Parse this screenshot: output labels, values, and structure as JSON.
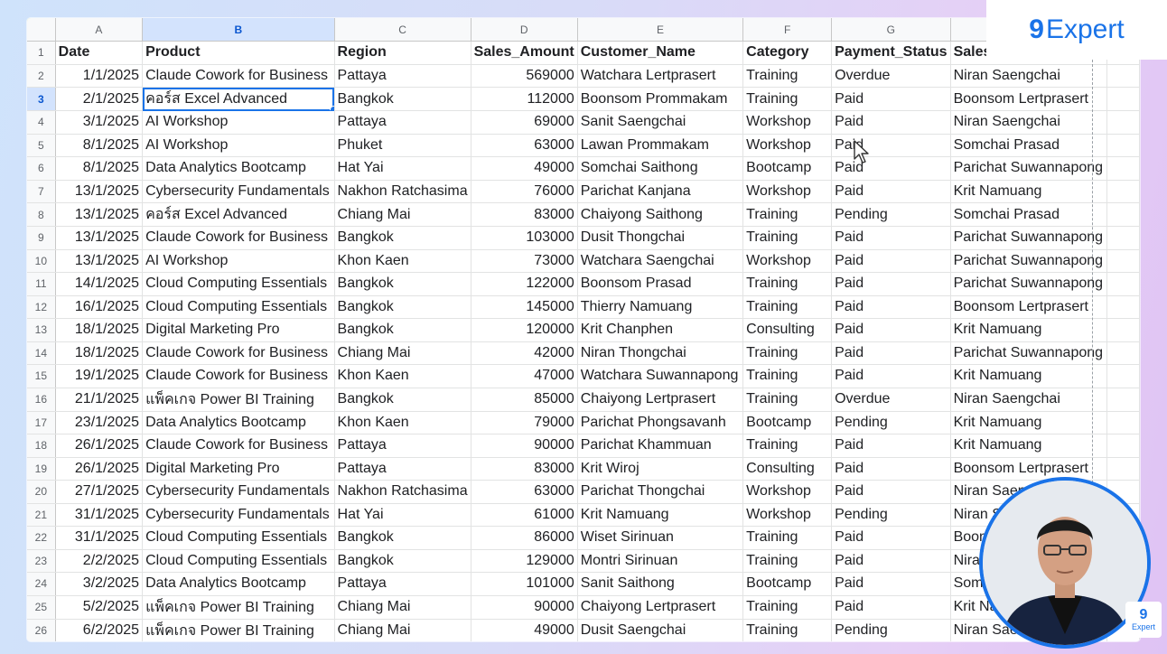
{
  "brand": {
    "logo_mark": "9",
    "logo_text": "Expert",
    "mini_mark": "9",
    "mini_text": "Expert"
  },
  "colors": {
    "accent": "#1a73e8",
    "selection": "#d3e3fd"
  },
  "sheet": {
    "column_letters": [
      "A",
      "B",
      "C",
      "D",
      "E",
      "F",
      "G",
      ""
    ],
    "headers": [
      "Date",
      "Product",
      "Region",
      "Sales_Amount",
      "Customer_Name",
      "Category",
      "Payment_Status",
      "Sales_Rep"
    ],
    "selected_column": "B",
    "active_cell": "B3",
    "rows": [
      [
        "1/1/2025",
        "Claude Cowork for Business",
        "Pattaya",
        "569000",
        "Watchara Lertprasert",
        "Training",
        "Overdue",
        "Niran Saengchai"
      ],
      [
        "2/1/2025",
        "คอร์ส Excel Advanced",
        "Bangkok",
        "112000",
        "Boonsom Prommakam",
        "Training",
        "Paid",
        "Boonsom Lertprasert"
      ],
      [
        "3/1/2025",
        "AI Workshop",
        "Pattaya",
        "69000",
        "Sanit Saengchai",
        "Workshop",
        "Paid",
        "Niran Saengchai"
      ],
      [
        "8/1/2025",
        "AI Workshop",
        "Phuket",
        "63000",
        "Lawan Prommakam",
        "Workshop",
        "Paid",
        "Somchai Prasad"
      ],
      [
        "8/1/2025",
        "Data Analytics Bootcamp",
        "Hat Yai",
        "49000",
        "Somchai Saithong",
        "Bootcamp",
        "Paid",
        "Parichat Suwannapong"
      ],
      [
        "13/1/2025",
        "Cybersecurity Fundamentals",
        "Nakhon Ratchasima",
        "76000",
        "Parichat Kanjana",
        "Workshop",
        "Paid",
        "Krit Namuang"
      ],
      [
        "13/1/2025",
        "คอร์ส Excel Advanced",
        "Chiang Mai",
        "83000",
        "Chaiyong Saithong",
        "Training",
        "Pending",
        "Somchai Prasad"
      ],
      [
        "13/1/2025",
        "Claude Cowork for Business",
        "Bangkok",
        "103000",
        "Dusit Thongchai",
        "Training",
        "Paid",
        "Parichat Suwannapong"
      ],
      [
        "13/1/2025",
        "AI Workshop",
        "Khon Kaen",
        "73000",
        "Watchara Saengchai",
        "Workshop",
        "Paid",
        "Parichat Suwannapong"
      ],
      [
        "14/1/2025",
        "Cloud Computing Essentials",
        "Bangkok",
        "122000",
        "Boonsom Prasad",
        "Training",
        "Paid",
        "Parichat Suwannapong"
      ],
      [
        "16/1/2025",
        "Cloud Computing Essentials",
        "Bangkok",
        "145000",
        "Thierry Namuang",
        "Training",
        "Paid",
        "Boonsom Lertprasert"
      ],
      [
        "18/1/2025",
        "Digital Marketing Pro",
        "Bangkok",
        "120000",
        "Krit Chanphen",
        "Consulting",
        "Paid",
        "Krit Namuang"
      ],
      [
        "18/1/2025",
        "Claude Cowork for Business",
        "Chiang Mai",
        "42000",
        "Niran Thongchai",
        "Training",
        "Paid",
        "Parichat Suwannapong"
      ],
      [
        "19/1/2025",
        "Claude Cowork for Business",
        "Khon Kaen",
        "47000",
        "Watchara Suwannapong",
        "Training",
        "Paid",
        "Krit Namuang"
      ],
      [
        "21/1/2025",
        "แพ็คเกจ Power BI Training",
        "Bangkok",
        "85000",
        "Chaiyong Lertprasert",
        "Training",
        "Overdue",
        "Niran Saengchai"
      ],
      [
        "23/1/2025",
        "Data Analytics Bootcamp",
        "Khon Kaen",
        "79000",
        "Parichat Phongsavanh",
        "Bootcamp",
        "Pending",
        "Krit Namuang"
      ],
      [
        "26/1/2025",
        "Claude Cowork for Business",
        "Pattaya",
        "90000",
        "Parichat Khammuan",
        "Training",
        "Paid",
        "Krit Namuang"
      ],
      [
        "26/1/2025",
        "Digital Marketing Pro",
        "Pattaya",
        "83000",
        "Krit Wiroj",
        "Consulting",
        "Paid",
        "Boonsom Lertprasert"
      ],
      [
        "27/1/2025",
        "Cybersecurity Fundamentals",
        "Nakhon Ratchasima",
        "63000",
        "Parichat Thongchai",
        "Workshop",
        "Paid",
        "Niran Saengchai"
      ],
      [
        "31/1/2025",
        "Cybersecurity Fundamentals",
        "Hat Yai",
        "61000",
        "Krit Namuang",
        "Workshop",
        "Pending",
        "Niran Saengchai"
      ],
      [
        "31/1/2025",
        "Cloud Computing Essentials",
        "Bangkok",
        "86000",
        "Wiset Sirinuan",
        "Training",
        "Paid",
        "Boonsom Lertprasert"
      ],
      [
        "2/2/2025",
        "Cloud Computing Essentials",
        "Bangkok",
        "129000",
        "Montri Sirinuan",
        "Training",
        "Paid",
        "Niran Saengchai"
      ],
      [
        "3/2/2025",
        "Data Analytics Bootcamp",
        "Pattaya",
        "101000",
        "Sanit Saithong",
        "Bootcamp",
        "Paid",
        "Somchai Prasad"
      ],
      [
        "5/2/2025",
        "แพ็คเกจ Power BI Training",
        "Chiang Mai",
        "90000",
        "Chaiyong Lertprasert",
        "Training",
        "Paid",
        "Krit Namuang"
      ],
      [
        "6/2/2025",
        "แพ็คเกจ Power BI Training",
        "Chiang Mai",
        "49000",
        "Dusit Saengchai",
        "Training",
        "Pending",
        "Niran Saengchai"
      ]
    ]
  }
}
